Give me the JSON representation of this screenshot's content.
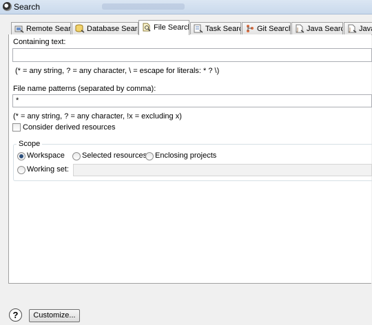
{
  "window": {
    "title": "Search"
  },
  "tabs": [
    {
      "label": "Remote Search",
      "icon": "remote-search-icon",
      "active": false
    },
    {
      "label": "Database Search",
      "icon": "database-search-icon",
      "active": false
    },
    {
      "label": "File Search",
      "icon": "file-search-icon",
      "active": true
    },
    {
      "label": "Task Search",
      "icon": "task-search-icon",
      "active": false
    },
    {
      "label": "Git Search",
      "icon": "git-search-icon",
      "active": false
    },
    {
      "label": "Java Search",
      "icon": "java-search-icon",
      "active": false
    },
    {
      "label": "JavaS",
      "icon": "javascript-search-icon",
      "active": false
    }
  ],
  "containing_text": {
    "label": "Containing text:",
    "value": "",
    "hint": "(* = any string, ? = any character, \\ = escape for literals: * ? \\)"
  },
  "file_patterns": {
    "label": "File name patterns (separated by comma):",
    "value": "*",
    "hint": "(* = any string, ? = any character, !x = excluding x)"
  },
  "derived": {
    "label": "Consider derived resources",
    "checked": false
  },
  "scope": {
    "title": "Scope",
    "options": [
      {
        "label": "Workspace",
        "selected": true
      },
      {
        "label": "Selected resources",
        "selected": false
      },
      {
        "label": "Enclosing projects",
        "selected": false
      },
      {
        "label": "Working set:",
        "selected": false
      }
    ],
    "working_set_value": ""
  },
  "footer": {
    "help_label": "?",
    "customize_label": "Customize..."
  },
  "colors": {
    "accent": "#2c4f7c",
    "tab_border": "#a0a0a0",
    "field_border": "#abadb3"
  }
}
